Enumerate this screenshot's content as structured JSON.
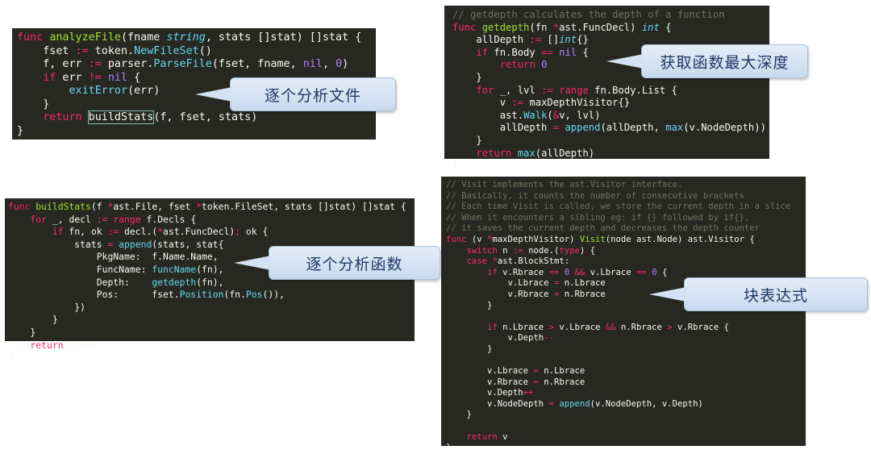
{
  "panels": [
    {
      "id": "analyze-file",
      "lines": [
        [
          [
            "kw",
            "func "
          ],
          [
            "fn",
            "analyzeFile"
          ],
          [
            "pl",
            "(fname "
          ],
          [
            "ty",
            "string"
          ],
          [
            "pl",
            ", stats []stat) []stat {"
          ]
        ],
        [
          [
            "pl",
            "    fset "
          ],
          [
            "op",
            ":="
          ],
          [
            "pl",
            " token."
          ],
          [
            "bi",
            "NewFileSet"
          ],
          [
            "pl",
            "()"
          ]
        ],
        [
          [
            "pl",
            "    f, err "
          ],
          [
            "op",
            ":="
          ],
          [
            "pl",
            " parser."
          ],
          [
            "bi",
            "ParseFile"
          ],
          [
            "pl",
            "(fset, fname, "
          ],
          [
            "num",
            "nil"
          ],
          [
            "pl",
            ", "
          ],
          [
            "num",
            "0"
          ],
          [
            "pl",
            ")"
          ]
        ],
        [
          [
            "kw",
            "    if"
          ],
          [
            "pl",
            " err "
          ],
          [
            "op",
            "!="
          ],
          [
            "pl",
            " "
          ],
          [
            "num",
            "nil"
          ],
          [
            "pl",
            " {"
          ]
        ],
        [
          [
            "pl",
            "        "
          ],
          [
            "bi",
            "exitError"
          ],
          [
            "pl",
            "(err)"
          ]
        ],
        [
          [
            "pl",
            "    }"
          ]
        ],
        [
          [
            "kw",
            "    return"
          ],
          [
            "pl",
            " "
          ],
          [
            "hl",
            "buildStats"
          ],
          [
            "pl",
            "(f, fset, stats)"
          ]
        ],
        [
          [
            "pl",
            "}"
          ]
        ]
      ]
    },
    {
      "id": "get-depth",
      "lines": [
        [
          [
            "cm",
            "// getdepth calculates the depth of a function"
          ]
        ],
        [
          [
            "kw",
            "func "
          ],
          [
            "fn",
            "getdepth"
          ],
          [
            "pl",
            "(fn "
          ],
          [
            "op",
            "*"
          ],
          [
            "pl",
            "ast.FuncDecl) "
          ],
          [
            "ty",
            "int"
          ],
          [
            "pl",
            " {"
          ]
        ],
        [
          [
            "pl",
            "    allDepth "
          ],
          [
            "op",
            ":="
          ],
          [
            "pl",
            " []"
          ],
          [
            "ty",
            "int"
          ],
          [
            "pl",
            "{}"
          ]
        ],
        [
          [
            "kw",
            "    if"
          ],
          [
            "pl",
            " fn.Body "
          ],
          [
            "op",
            "=="
          ],
          [
            "pl",
            " "
          ],
          [
            "num",
            "nil"
          ],
          [
            "pl",
            " {"
          ]
        ],
        [
          [
            "kw",
            "        return"
          ],
          [
            "pl",
            " "
          ],
          [
            "num",
            "0"
          ]
        ],
        [
          [
            "pl",
            "    }"
          ]
        ],
        [
          [
            "kw",
            "    for"
          ],
          [
            "pl",
            " _, lvl "
          ],
          [
            "op",
            ":="
          ],
          [
            "kw",
            " range"
          ],
          [
            "pl",
            " fn.Body.List {"
          ]
        ],
        [
          [
            "pl",
            "        v "
          ],
          [
            "op",
            ":="
          ],
          [
            "pl",
            " maxDepthVisitor{}"
          ]
        ],
        [
          [
            "pl",
            "        ast."
          ],
          [
            "bi",
            "Walk"
          ],
          [
            "pl",
            "("
          ],
          [
            "op",
            "&"
          ],
          [
            "pl",
            "v, lvl)"
          ]
        ],
        [
          [
            "pl",
            "        allDepth "
          ],
          [
            "op",
            "="
          ],
          [
            "pl",
            " "
          ],
          [
            "bi",
            "append"
          ],
          [
            "pl",
            "(allDepth, "
          ],
          [
            "bi",
            "max"
          ],
          [
            "pl",
            "(v.NodeDepth))"
          ]
        ],
        [
          [
            "pl",
            "    }"
          ]
        ],
        [
          [
            "kw",
            "    return"
          ],
          [
            "pl",
            " "
          ],
          [
            "bi",
            "max"
          ],
          [
            "pl",
            "(allDepth)"
          ]
        ],
        [
          [
            "pl",
            "}"
          ]
        ]
      ]
    },
    {
      "id": "build-stats",
      "lines": [
        [
          [
            "kw",
            "func "
          ],
          [
            "fn",
            "buildStats"
          ],
          [
            "pl",
            "(f "
          ],
          [
            "op",
            "*"
          ],
          [
            "pl",
            "ast.File, fset "
          ],
          [
            "op",
            "*"
          ],
          [
            "pl",
            "token.FileSet, stats []stat) []stat {"
          ]
        ],
        [
          [
            "kw",
            "    for"
          ],
          [
            "pl",
            " _, decl "
          ],
          [
            "op",
            ":="
          ],
          [
            "kw",
            " range"
          ],
          [
            "pl",
            " f.Decls {"
          ]
        ],
        [
          [
            "kw",
            "        if"
          ],
          [
            "pl",
            " fn, ok "
          ],
          [
            "op",
            ":="
          ],
          [
            "pl",
            " decl.("
          ],
          [
            "op",
            "*"
          ],
          [
            "pl",
            "ast.FuncDecl)"
          ],
          [
            "op",
            ";"
          ],
          [
            "pl",
            " ok {"
          ]
        ],
        [
          [
            "pl",
            "            stats "
          ],
          [
            "op",
            "="
          ],
          [
            "pl",
            " "
          ],
          [
            "bi",
            "append"
          ],
          [
            "pl",
            "(stats, stat{"
          ]
        ],
        [
          [
            "pl",
            "                PkgName:  f.Name.Name,"
          ]
        ],
        [
          [
            "pl",
            "                FuncName: "
          ],
          [
            "bi",
            "funcName"
          ],
          [
            "pl",
            "(fn),"
          ]
        ],
        [
          [
            "pl",
            "                Depth:    "
          ],
          [
            "bi",
            "getdepth"
          ],
          [
            "pl",
            "(fn),"
          ]
        ],
        [
          [
            "pl",
            "                Pos:      fset."
          ],
          [
            "bi",
            "Position"
          ],
          [
            "pl",
            "(fn."
          ],
          [
            "bi",
            "Pos"
          ],
          [
            "pl",
            "()),"
          ]
        ],
        [
          [
            "pl",
            "            })"
          ]
        ],
        [
          [
            "pl",
            "        }"
          ]
        ],
        [
          [
            "pl",
            "    }"
          ]
        ],
        [
          [
            "kw",
            "    return"
          ],
          [
            "pl",
            " stats"
          ]
        ],
        [
          [
            "pl",
            "}"
          ]
        ]
      ]
    },
    {
      "id": "visit",
      "lines": [
        [
          [
            "cm",
            "// Visit implements the ast.Visitor interface."
          ]
        ],
        [
          [
            "cm",
            "// Basically, it counts the number of consecutive brackets"
          ]
        ],
        [
          [
            "cm",
            "// Each time Visit is called, we store the current depth in a slice"
          ]
        ],
        [
          [
            "cm",
            "// When it encounters a sibling eg: if {} followed by if{},"
          ]
        ],
        [
          [
            "cm",
            "// it saves the current depth and decreases the depth counter"
          ]
        ],
        [
          [
            "kw",
            "func"
          ],
          [
            "pl",
            " (v "
          ],
          [
            "op",
            "*"
          ],
          [
            "pl",
            "maxDepthVisitor) "
          ],
          [
            "fn",
            "Visit"
          ],
          [
            "pl",
            "(node ast.Node) ast.Visitor {"
          ]
        ],
        [
          [
            "kw",
            "    switch"
          ],
          [
            "pl",
            " n "
          ],
          [
            "op",
            ":="
          ],
          [
            "pl",
            " node.("
          ],
          [
            "kw",
            "type"
          ],
          [
            "pl",
            ") {"
          ]
        ],
        [
          [
            "kw",
            "    case"
          ],
          [
            "pl",
            " "
          ],
          [
            "op",
            "*"
          ],
          [
            "pl",
            "ast.BlockStmt:"
          ]
        ],
        [
          [
            "kw",
            "        if"
          ],
          [
            "pl",
            " v.Rbrace "
          ],
          [
            "op",
            "=="
          ],
          [
            "pl",
            " "
          ],
          [
            "num",
            "0"
          ],
          [
            "pl",
            " "
          ],
          [
            "op",
            "&&"
          ],
          [
            "pl",
            " v.Lbrace "
          ],
          [
            "op",
            "=="
          ],
          [
            "pl",
            " "
          ],
          [
            "num",
            "0"
          ],
          [
            "pl",
            " {"
          ]
        ],
        [
          [
            "pl",
            "            v.Lbrace "
          ],
          [
            "op",
            "="
          ],
          [
            "pl",
            " n.Lbrace"
          ]
        ],
        [
          [
            "pl",
            "            v.Rbrace "
          ],
          [
            "op",
            "="
          ],
          [
            "pl",
            " n.Rbrace"
          ]
        ],
        [
          [
            "pl",
            "        }"
          ]
        ],
        [
          [
            "pl",
            ""
          ]
        ],
        [
          [
            "kw",
            "        if"
          ],
          [
            "pl",
            " n.Lbrace "
          ],
          [
            "op",
            ">"
          ],
          [
            "pl",
            " v.Lbrace "
          ],
          [
            "op",
            "&&"
          ],
          [
            "pl",
            " n.Rbrace "
          ],
          [
            "op",
            ">"
          ],
          [
            "pl",
            " v.Rbrace {"
          ]
        ],
        [
          [
            "pl",
            "            v.Depth"
          ],
          [
            "op",
            "--"
          ]
        ],
        [
          [
            "pl",
            "        }"
          ]
        ],
        [
          [
            "pl",
            ""
          ]
        ],
        [
          [
            "pl",
            "        v.Lbrace "
          ],
          [
            "op",
            "="
          ],
          [
            "pl",
            " n.Lbrace"
          ]
        ],
        [
          [
            "pl",
            "        v.Rbrace "
          ],
          [
            "op",
            "="
          ],
          [
            "pl",
            " n.Rbrace"
          ]
        ],
        [
          [
            "pl",
            "        v.Depth"
          ],
          [
            "op",
            "++"
          ]
        ],
        [
          [
            "pl",
            "        v.NodeDepth "
          ],
          [
            "op",
            "="
          ],
          [
            "pl",
            " "
          ],
          [
            "bi",
            "append"
          ],
          [
            "pl",
            "(v.NodeDepth, v.Depth)"
          ]
        ],
        [
          [
            "pl",
            "    }"
          ]
        ],
        [
          [
            "pl",
            ""
          ]
        ],
        [
          [
            "kw",
            "    return"
          ],
          [
            "pl",
            " v"
          ]
        ],
        [
          [
            "pl",
            "}"
          ]
        ]
      ]
    }
  ],
  "callouts": {
    "analyze_file": "逐个分析文件",
    "get_depth": "获取函数最大深度",
    "build_stats": "逐个分析函数",
    "block_stmt": "块表达式"
  },
  "colors": {
    "code_background": "#272822",
    "keyword": "#f92672",
    "function_name": "#a6e22e",
    "builtin": "#66d9ef",
    "number": "#ae81ff",
    "comment": "#75715e",
    "callout_text": "#1f3864",
    "callout_fill": "#d3e2f2"
  }
}
